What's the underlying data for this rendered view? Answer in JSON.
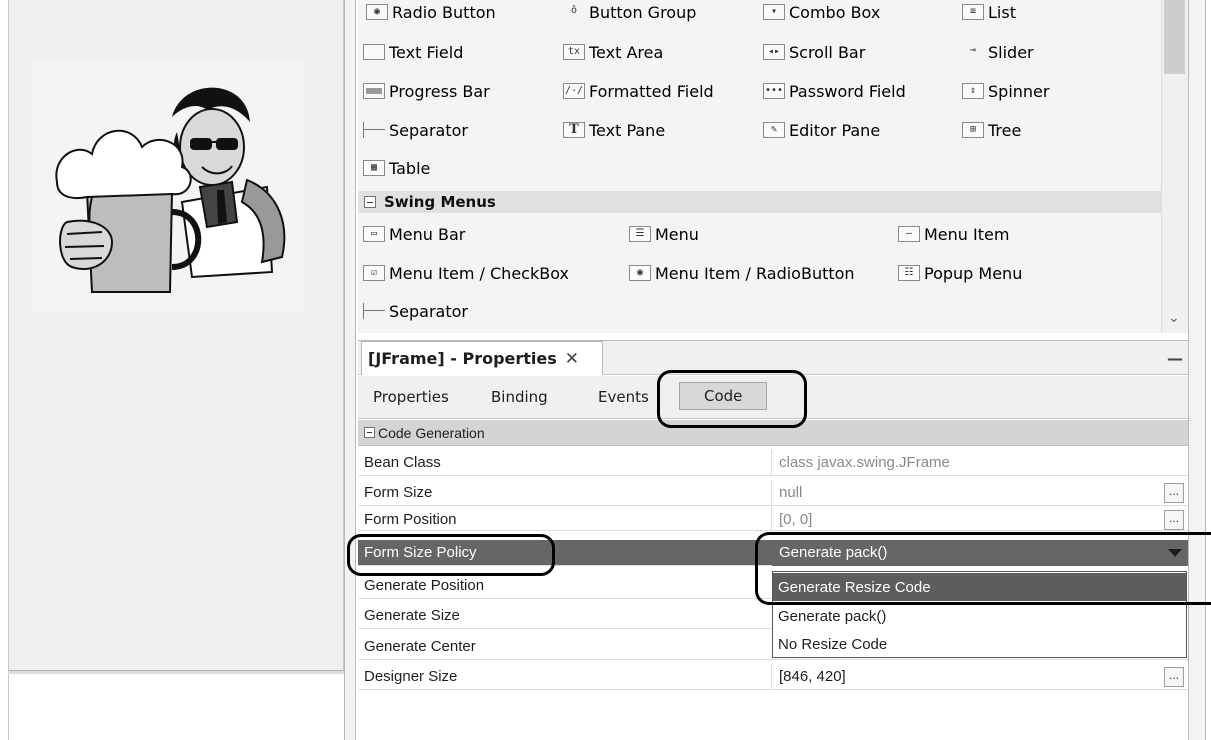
{
  "palette": {
    "swing_controls_rows": [
      [
        "Radio Button",
        "Button Group",
        "Combo Box",
        "List"
      ],
      [
        "Text Field",
        "Text Area",
        "Scroll Bar",
        "Slider"
      ],
      [
        "Progress Bar",
        "Formatted Field",
        "Password Field",
        "Spinner"
      ],
      [
        "Separator",
        "Text Pane",
        "Editor Pane",
        "Tree"
      ],
      [
        "Table"
      ]
    ],
    "menus_header": "Swing Menus",
    "swing_menus_rows": [
      [
        "Menu Bar",
        "Menu",
        "Menu Item"
      ],
      [
        "Menu Item / CheckBox",
        "Menu Item / RadioButton",
        "Popup Menu"
      ],
      [
        "Separator"
      ]
    ],
    "icons": {
      "area_glyph": "tx",
      "pane_glyph": "T"
    }
  },
  "properties": {
    "window_title": "[JFrame] - Properties",
    "close_glyph": "✕",
    "minimize_glyph": "—",
    "tabs": [
      "Properties",
      "Binding",
      "Events",
      "Code"
    ],
    "active_tab": "Code",
    "group": "Code Generation",
    "rows": [
      {
        "name": "Bean Class",
        "value": "class javax.swing.JFrame",
        "greyed": true,
        "has_button": false
      },
      {
        "name": "Form Size",
        "value": "null",
        "greyed": true,
        "has_button": true
      },
      {
        "name": "Form Position",
        "value": "[0, 0]",
        "greyed": true,
        "has_button": true
      },
      {
        "name": "Form Size Policy",
        "value": "Generate pack()",
        "selected": true
      },
      {
        "name": "Generate Position",
        "value": ""
      },
      {
        "name": "Generate Size",
        "value": ""
      },
      {
        "name": "Generate Center",
        "value": ""
      },
      {
        "name": "Designer Size",
        "value": "[846, 420]",
        "has_button": true
      }
    ],
    "dropdown_options": [
      "Generate Resize Code",
      "Generate pack()",
      "No Resize Code"
    ],
    "dropdown_highlighted": "Generate Resize Code",
    "ellipsis": "..."
  },
  "colors": {
    "selected_row": "#666666",
    "highlight_option": "#5d5d5d",
    "group_header": "#d4d4d4"
  }
}
